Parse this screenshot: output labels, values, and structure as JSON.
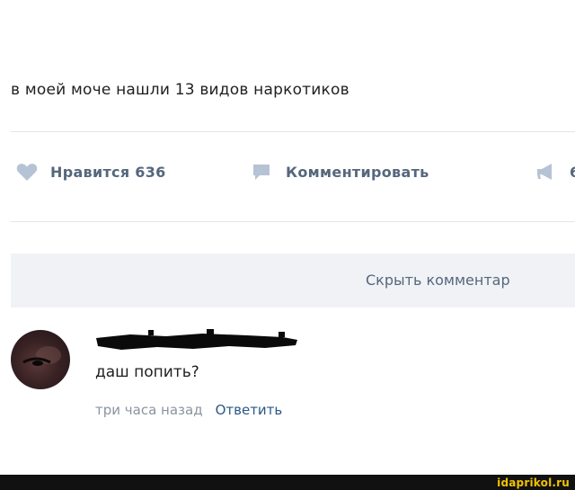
{
  "post": {
    "text": "в моей моче нашли 13 видов наркотиков"
  },
  "actions": {
    "like_label": "Нравится 636",
    "comment_label": "Комментировать",
    "share_label": "6"
  },
  "comments": {
    "hide_label": "Скрыть комментар"
  },
  "comment": {
    "text": "даш попить?",
    "time": "три часа назад",
    "reply_label": "Ответить"
  },
  "footer": {
    "watermark": "idaprikol.ru"
  },
  "colors": {
    "action_text": "#55677d",
    "icon": "#b5c3d4",
    "link": "#2a5885",
    "muted": "#8a949e",
    "watermark": "#f2c200"
  },
  "icons": [
    "heart-icon",
    "comment-icon",
    "megaphone-icon"
  ]
}
